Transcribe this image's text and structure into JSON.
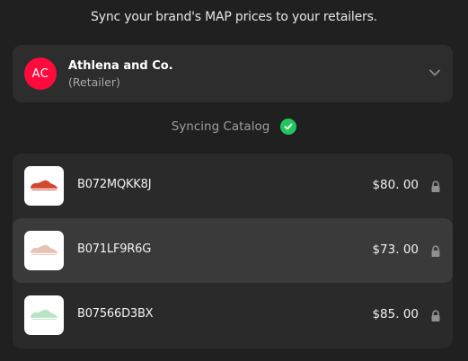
{
  "headline": "Sync your brand's MAP prices to your retailers.",
  "retailer": {
    "initials": "AC",
    "name": "Athlena and Co.",
    "role": "(Retailer)",
    "avatar_color": "#ff0a3c",
    "expand_icon": "chevron-down-icon"
  },
  "sync_status": {
    "label": "Syncing Catalog",
    "icon": "check-circle-icon",
    "color": "#22c55e"
  },
  "products": [
    {
      "sku": "B072MQKK8J",
      "price": "$80. 00",
      "shoe_color": "#d04a32",
      "selected": false,
      "lock_icon": "lock-icon"
    },
    {
      "sku": "B071LF9R6G",
      "price": "$73. 00",
      "shoe_color": "#e9c2b6",
      "selected": true,
      "lock_icon": "lock-icon"
    },
    {
      "sku": "B07566D3BX",
      "price": "$85. 00",
      "shoe_color": "#b9e3c6",
      "selected": false,
      "lock_icon": "lock-icon"
    }
  ]
}
